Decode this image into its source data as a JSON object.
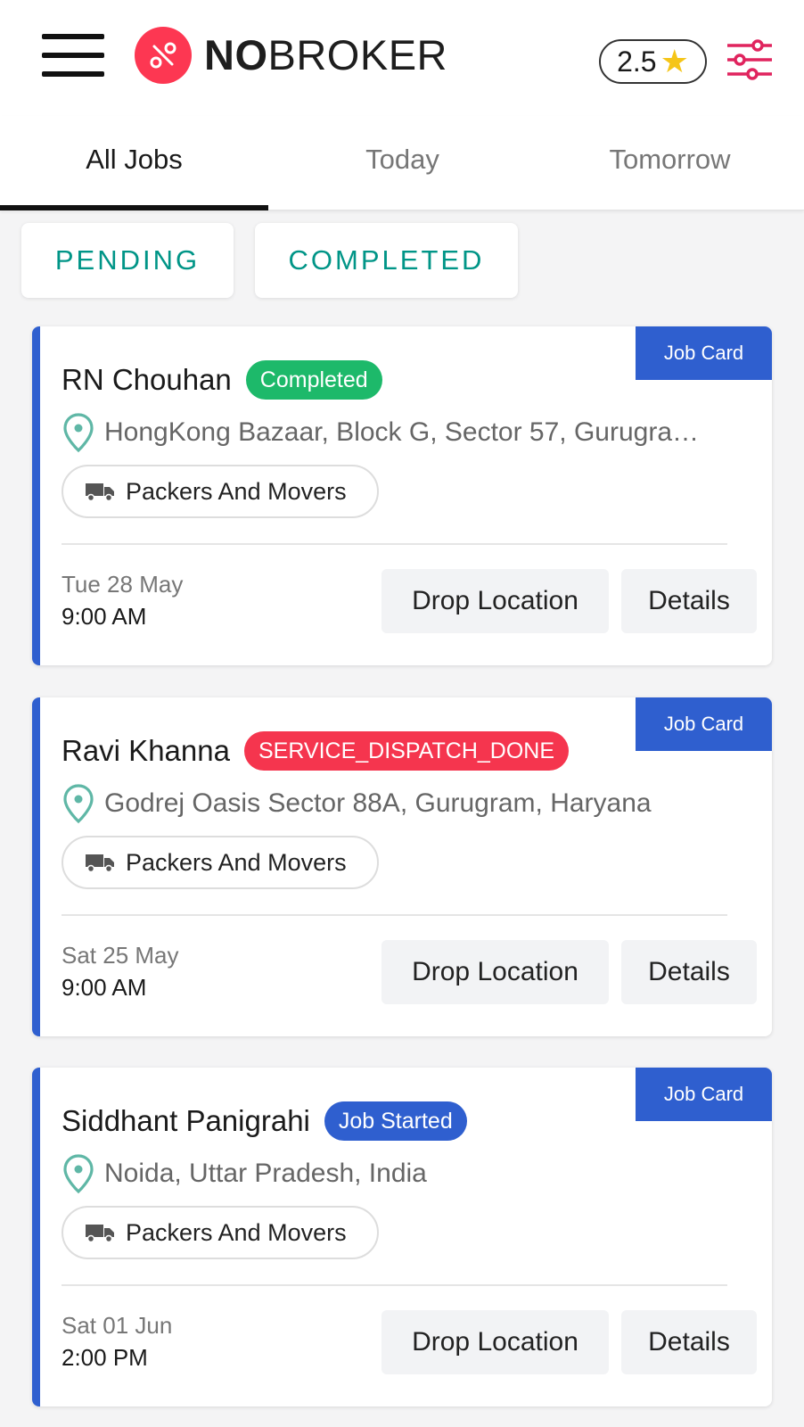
{
  "header": {
    "logo_bold": "NO",
    "logo_regular": "BROKER",
    "rating": "2.5",
    "brand_color": "#fd3752"
  },
  "tabs": [
    {
      "label": "All Jobs",
      "active": true
    },
    {
      "label": "Today",
      "active": false
    },
    {
      "label": "Tomorrow",
      "active": false
    }
  ],
  "filters": {
    "pending": "PENDING",
    "completed": "COMPLETED",
    "color": "#009587"
  },
  "jobs": [
    {
      "name": "RN Chouhan",
      "status": "Completed",
      "status_color": "#1db96a",
      "address": "HongKong Bazaar, Block G, Sector 57, Gurugra…",
      "service": "Packers And Movers",
      "date": "Tue 28 May",
      "time": "9:00 AM",
      "job_card": "Job Card",
      "drop_label": "Drop Location",
      "details_label": "Details"
    },
    {
      "name": "Ravi Khanna",
      "status": "SERVICE_DISPATCH_DONE",
      "status_color": "#f5354e",
      "address": "Godrej Oasis Sector 88A, Gurugram, Haryana",
      "service": "Packers And Movers",
      "date": "Sat 25 May",
      "time": "9:00 AM",
      "job_card": "Job Card",
      "drop_label": "Drop Location",
      "details_label": "Details"
    },
    {
      "name": "Siddhant Panigrahi",
      "status": "Job Started",
      "status_color": "#2f5fcf",
      "address": "Noida, Uttar Pradesh, India",
      "service": "Packers And Movers",
      "date": "Sat 01 Jun",
      "time": "2:00 PM",
      "job_card": "Job Card",
      "drop_label": "Drop Location",
      "details_label": "Details"
    }
  ],
  "icons": {
    "menu": "hamburger-menu-icon",
    "logo": "nobroker-logo-icon",
    "rating": "star-icon",
    "filter": "sliders-filter-icon",
    "location": "location-pin-icon",
    "service": "truck-icon"
  },
  "accent_color": "#2f5fcf"
}
